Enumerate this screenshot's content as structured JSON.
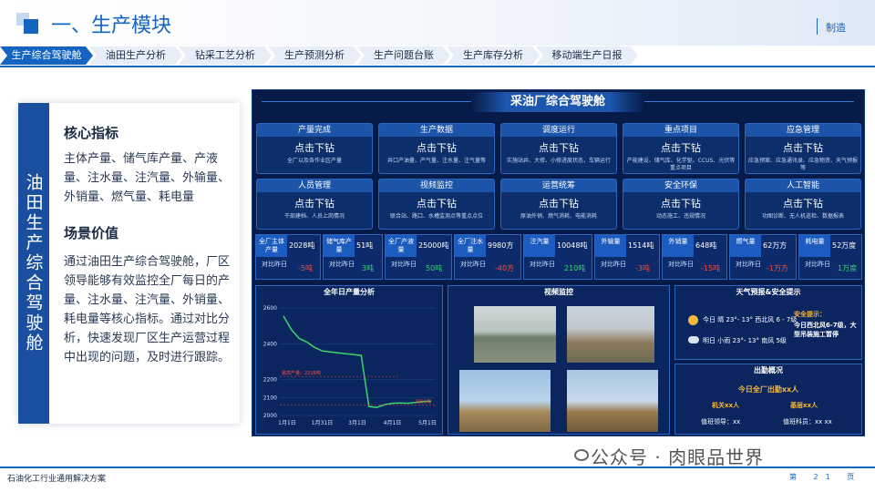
{
  "header": {
    "title": "一、生产模块",
    "tag": "制造"
  },
  "tabs": [
    "生产综合驾驶舱",
    "油田生产分析",
    "钻采工艺分析",
    "生产预测分析",
    "生产问题台账",
    "生产库存分析",
    "移动端生产日报"
  ],
  "left": {
    "vertical_title": "油田生产综合驾驶舱",
    "h1": "核心指标",
    "p1": "主体产量、储气库产量、产液量、注水量、注汽量、外输量、外销量、燃气量、耗电量",
    "h2": "场景价值",
    "p2": "通过油田生产综合驾驶舱，厂区领导能够有效监控全厂每日的产量、注水量、注汽量、外销量、耗电量等核心指标。通过对比分析，快速发现厂区生产运营过程中出现的问题，及时进行跟踪。"
  },
  "dashboard": {
    "title": "采油厂综合驾驶舱",
    "cards": [
      {
        "title": "产量完成",
        "sub": "点击下钻",
        "desc": "全厂以及各作业区产量"
      },
      {
        "title": "生产数据",
        "sub": "点击下钻",
        "desc": "井口产油量、产气量、注水量、注气量等"
      },
      {
        "title": "调度运行",
        "sub": "点击下钻",
        "desc": "实施站井、大修、小修进度状态，车辆运行"
      },
      {
        "title": "重点项目",
        "sub": "点击下钻",
        "desc": "产能建设、储气库、化学驱、CCUS、光伏等重点项目"
      },
      {
        "title": "应急管理",
        "sub": "点击下钻",
        "desc": "应急预案、应急通讯录、应急物资、天气预报等"
      },
      {
        "title": "人员管理",
        "sub": "点击下钻",
        "desc": "干部建档、人员上岗情况"
      },
      {
        "title": "视频监控",
        "sub": "点击下钻",
        "desc": "联合站、路口、水槽监测点等重点点位"
      },
      {
        "title": "运营统筹",
        "sub": "点击下钻",
        "desc": "原油外销、燃气消耗、电能消耗"
      },
      {
        "title": "安全环保",
        "sub": "点击下钻",
        "desc": "动态施工、违规情况"
      },
      {
        "title": "人工智能",
        "sub": "点击下钻",
        "desc": "功图诊断、无人机巡检、数据报表"
      }
    ],
    "kpis": [
      {
        "head": "全厂主体产量",
        "value": "2028吨",
        "label": "对比昨日",
        "delta": "-5吨",
        "up": false
      },
      {
        "head": "储气库产量",
        "value": "51吨",
        "label": "对比昨日",
        "delta": "3吨",
        "up": true
      },
      {
        "head": "全厂产液量",
        "value": "25000吨",
        "label": "对比昨日",
        "delta": "50吨",
        "up": true
      },
      {
        "head": "全厂注水量",
        "value": "9980方",
        "label": "对比昨日",
        "delta": "-40方",
        "up": false
      },
      {
        "head": "注汽量",
        "value": "10048吨",
        "label": "对比昨日",
        "delta": "210吨",
        "up": true
      },
      {
        "head": "外输量",
        "value": "1514吨",
        "label": "对比昨日",
        "delta": "-3吨",
        "up": false
      },
      {
        "head": "外销量",
        "value": "648吨",
        "label": "对比昨日",
        "delta": "-15吨",
        "up": false
      },
      {
        "head": "燃气量",
        "value": "62万方",
        "label": "对比昨日",
        "delta": "-1万方",
        "up": false
      },
      {
        "head": "耗电量",
        "value": "52万度",
        "label": "对比昨日",
        "delta": "1万度",
        "up": true
      }
    ],
    "chart_panel_title": "全年日产量分析",
    "video_title": "视频监控",
    "weather": {
      "title": "天气预报&安全提示",
      "today": "今日 晴 23°- 13° 西北风 6 - 7级",
      "tomorrow": "明日 小雨 23°- 13° 南风 5级",
      "tip_label": "安全提示：",
      "tip": "今日西北风6-7级，大型吊装施工暂停"
    },
    "attendance": {
      "title": "出勤概况",
      "total": "今日全厂出勤xx人",
      "jiguan": "机关xx人",
      "jiceng": "基层xx人",
      "duty_leader": "值班领导：xx",
      "duty_staff": "值班科员：xx xx"
    }
  },
  "chart_data": {
    "type": "line",
    "title": "全年日产量分析",
    "x": [
      "1月1日",
      "1月31日",
      "3月1日",
      "4月1日",
      "5月1日"
    ],
    "y_ticks": [
      2000,
      2100,
      2200,
      2400,
      2600
    ],
    "ylim": [
      2000,
      2600
    ],
    "series": [
      {
        "values": [
          2555,
          2480,
          2430,
          2410,
          2380,
          2360,
          2355,
          2350,
          2345,
          2340,
          2335,
          2050,
          2045,
          2060,
          2068,
          2070,
          2068,
          2072,
          2078,
          2080
        ]
      }
    ],
    "annotations": [
      "最高产量：2218吨",
      "2059吨"
    ]
  },
  "watermark": "公众号 · 肉眼品世界",
  "footer": {
    "text": "石油化工行业通用解决方案",
    "page": "第 21 页"
  },
  "colors": {
    "primary": "#1565c0",
    "dash_bg": "#071b48",
    "up": "#35d46a",
    "down": "#ff4a3a"
  }
}
